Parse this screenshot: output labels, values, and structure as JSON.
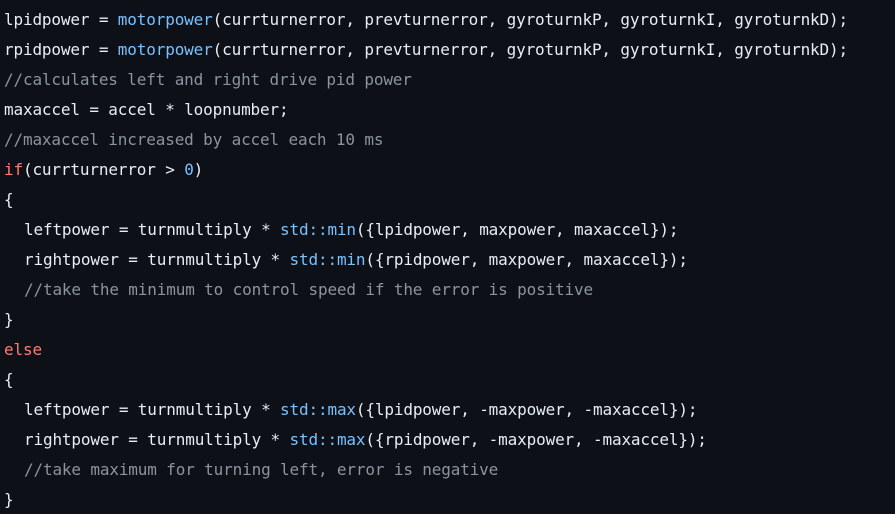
{
  "colors": {
    "background": "#0d1117",
    "text": "#e6edf3",
    "function": "#79c0ff",
    "keyword": "#ff7b72",
    "number": "#79c0ff",
    "comment": "#8b949e"
  },
  "code": {
    "line1": {
      "a": "lpidpower = ",
      "fn": "motorpower",
      "b": "(currturnerror, prevturnerror, gyroturnkP, gyroturnkI, gyroturnkD);"
    },
    "line2": {
      "a": "rpidpower = ",
      "fn": "motorpower",
      "b": "(currturnerror, prevturnerror, gyroturnkP, gyroturnkI, gyroturnkD);"
    },
    "line3": {
      "comment": "//calculates left and right drive pid power"
    },
    "line4": {
      "a": "maxaccel = accel * loopnumber;"
    },
    "line5": {
      "comment": "//maxaccel increased by accel each 10 ms"
    },
    "line6": {
      "kw": "if",
      "a": "(currturnerror > ",
      "num": "0",
      "b": ")"
    },
    "line7": {
      "a": "{"
    },
    "line8": {
      "a": "leftpower = turnmultiply * ",
      "fn": "std::min",
      "b": "({lpidpower, maxpower, maxaccel});"
    },
    "line9": {
      "a": "rightpower = turnmultiply * ",
      "fn": "std::min",
      "b": "({rpidpower, maxpower, maxaccel});"
    },
    "line10": {
      "comment": "//take the minimum to control speed if the error is positive"
    },
    "line11": {
      "a": "}"
    },
    "line12": {
      "kw": "else"
    },
    "line13": {
      "a": "{"
    },
    "line14": {
      "a": "leftpower = turnmultiply * ",
      "fn": "std::max",
      "b": "({lpidpower, -maxpower, -maxaccel});"
    },
    "line15": {
      "a": "rightpower = turnmultiply * ",
      "fn": "std::max",
      "b": "({rpidpower, -maxpower, -maxaccel});"
    },
    "line16": {
      "comment": "//take maximum for turning left, error is negative"
    },
    "line17": {
      "a": "}"
    }
  }
}
